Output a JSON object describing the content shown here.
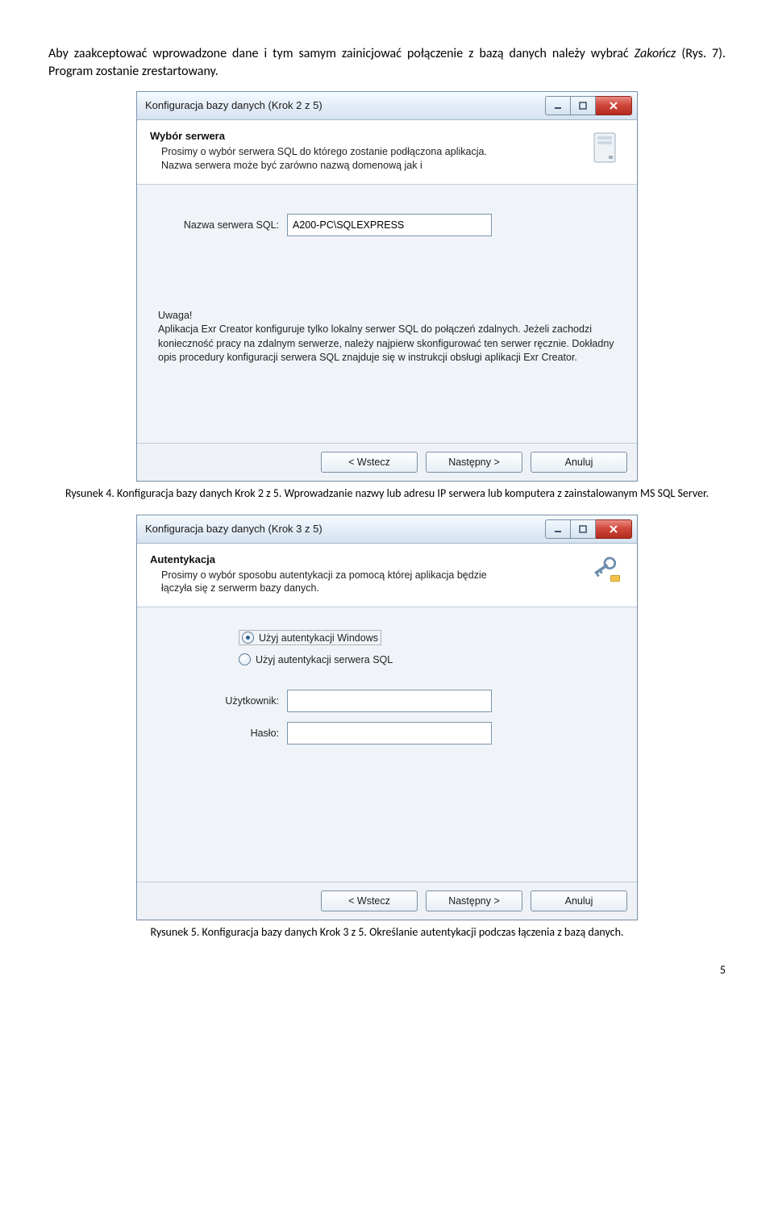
{
  "intro": {
    "text_before": "Aby zaakceptować wprowadzone dane i tym samym zainicjować połączenie z bazą danych należy wybrać ",
    "em": "Zakończ",
    "text_after": " (Rys. 7). Program zostanie zrestartowany."
  },
  "dialog1": {
    "title": "Konfiguracja bazy danych (Krok 2 z 5)",
    "header_title": "Wybór serwera",
    "header_desc": "Prosimy o wybór serwera SQL do którego zostanie podłączona aplikacja. Nazwa serwera może być zarówno nazwą domenową jak i",
    "server_label": "Nazwa serwera SQL:",
    "server_value": "A200-PC\\SQLEXPRESS",
    "warn_title": "Uwaga!",
    "warn_body": "Aplikacja Exr Creator konfiguruje tylko lokalny serwer SQL do połączeń zdalnych. Jeżeli zachodzi konieczność pracy na zdalnym serwerze, należy najpierw skonfigurować ten serwer ręcznie. Dokładny opis procedury konfiguracji serwera SQL znajduje się w instrukcji obsługi aplikacji Exr Creator.",
    "btn_back": "< Wstecz",
    "btn_next": "Następny >",
    "btn_cancel": "Anuluj"
  },
  "caption1": "Rysunek 4. Konfiguracja bazy danych Krok 2 z 5. Wprowadzanie nazwy lub adresu IP serwera lub komputera z zainstalowanym MS SQL Server.",
  "dialog2": {
    "title": "Konfiguracja bazy danych (Krok 3 z 5)",
    "header_title": "Autentykacja",
    "header_desc": "Prosimy o wybór sposobu autentykacji za pomocą której aplikacja będzie łączyła się z serwerm bazy danych.",
    "radio_windows": "Użyj autentykacji Windows",
    "radio_sql": "Użyj autentykacji serwera SQL",
    "user_label": "Użytkownik:",
    "pass_label": "Hasło:",
    "btn_back": "< Wstecz",
    "btn_next": "Następny >",
    "btn_cancel": "Anuluj"
  },
  "caption2": "Rysunek 5. Konfiguracja bazy danych Krok 3 z 5. Określanie autentykacji podczas łączenia z bazą danych.",
  "page_number": "5"
}
